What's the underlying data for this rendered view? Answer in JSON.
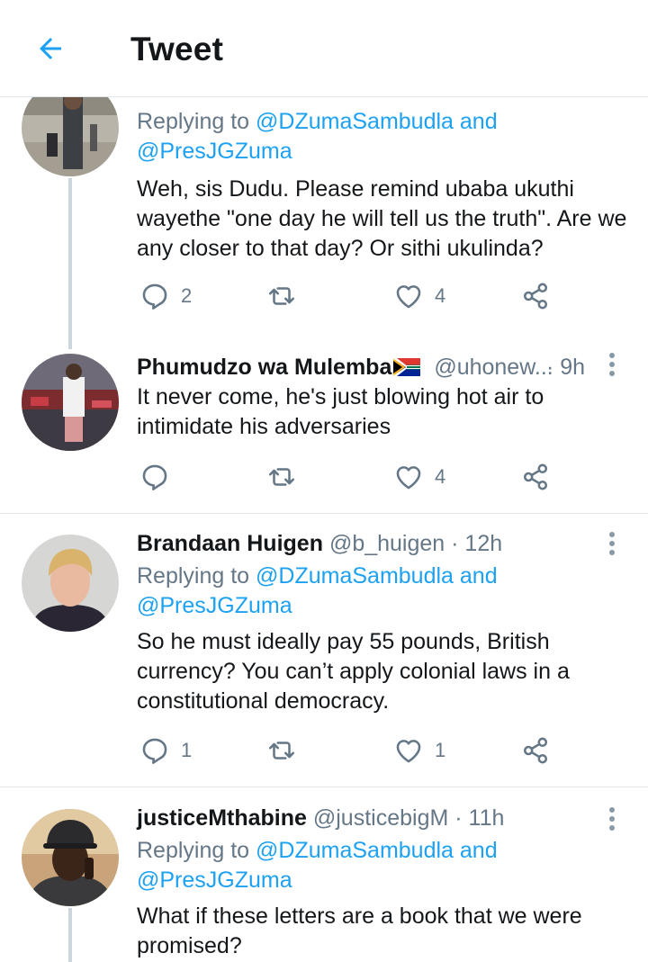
{
  "header": {
    "title": "Tweet",
    "back_icon": "arrow-left-icon",
    "accent": "#1da1f2"
  },
  "tweets": [
    {
      "reply_prefix": "Replying to",
      "reply_handle_1": "@DZumaSambudla",
      "reply_and": "and",
      "reply_handle_2": "@PresJGZuma",
      "text_lines": [
        "Weh, sis Dudu. Please remind ubaba ukuthi",
        "wayethe \"one day he will tell us the truth\". Are we",
        "any closer to that day? Or sithi ukulinda?"
      ],
      "reply_count": "2",
      "retweet_count": "",
      "like_count": "4"
    },
    {
      "name": "Phumudzo wa Mulemba",
      "name_emoji": "south-africa-flag",
      "handle": "@uhonew...",
      "time": "· 9h",
      "text_lines": [
        "It never come, he's just blowing hot air to",
        "intimidate his adversaries"
      ],
      "reply_count": "",
      "retweet_count": "",
      "like_count": "4"
    },
    {
      "name": "Brandaan Huigen",
      "handle": "@b_huigen",
      "time": "· 12h",
      "reply_prefix": "Replying to",
      "reply_handle_1": "@DZumaSambudla",
      "reply_and": "and",
      "reply_handle_2": "@PresJGZuma",
      "text_lines": [
        "So he must ideally pay 55 pounds, British",
        "currency? You can’t apply colonial laws in a",
        "constitutional democracy."
      ],
      "reply_count": "1",
      "retweet_count": "",
      "like_count": "1"
    },
    {
      "name": "justiceMthabine",
      "handle": "@justicebigM",
      "time": "· 11h",
      "reply_prefix": "Replying to",
      "reply_handle_1": "@DZumaSambudla",
      "reply_and": "and",
      "reply_handle_2": "@PresJGZuma",
      "text_lines": [
        "What if these letters are a book that we were",
        "promised?"
      ]
    }
  ],
  "icons": {
    "reply": "reply-icon",
    "retweet": "retweet-icon",
    "like": "heart-icon",
    "share": "share-icon",
    "more": "more-vertical-icon"
  }
}
